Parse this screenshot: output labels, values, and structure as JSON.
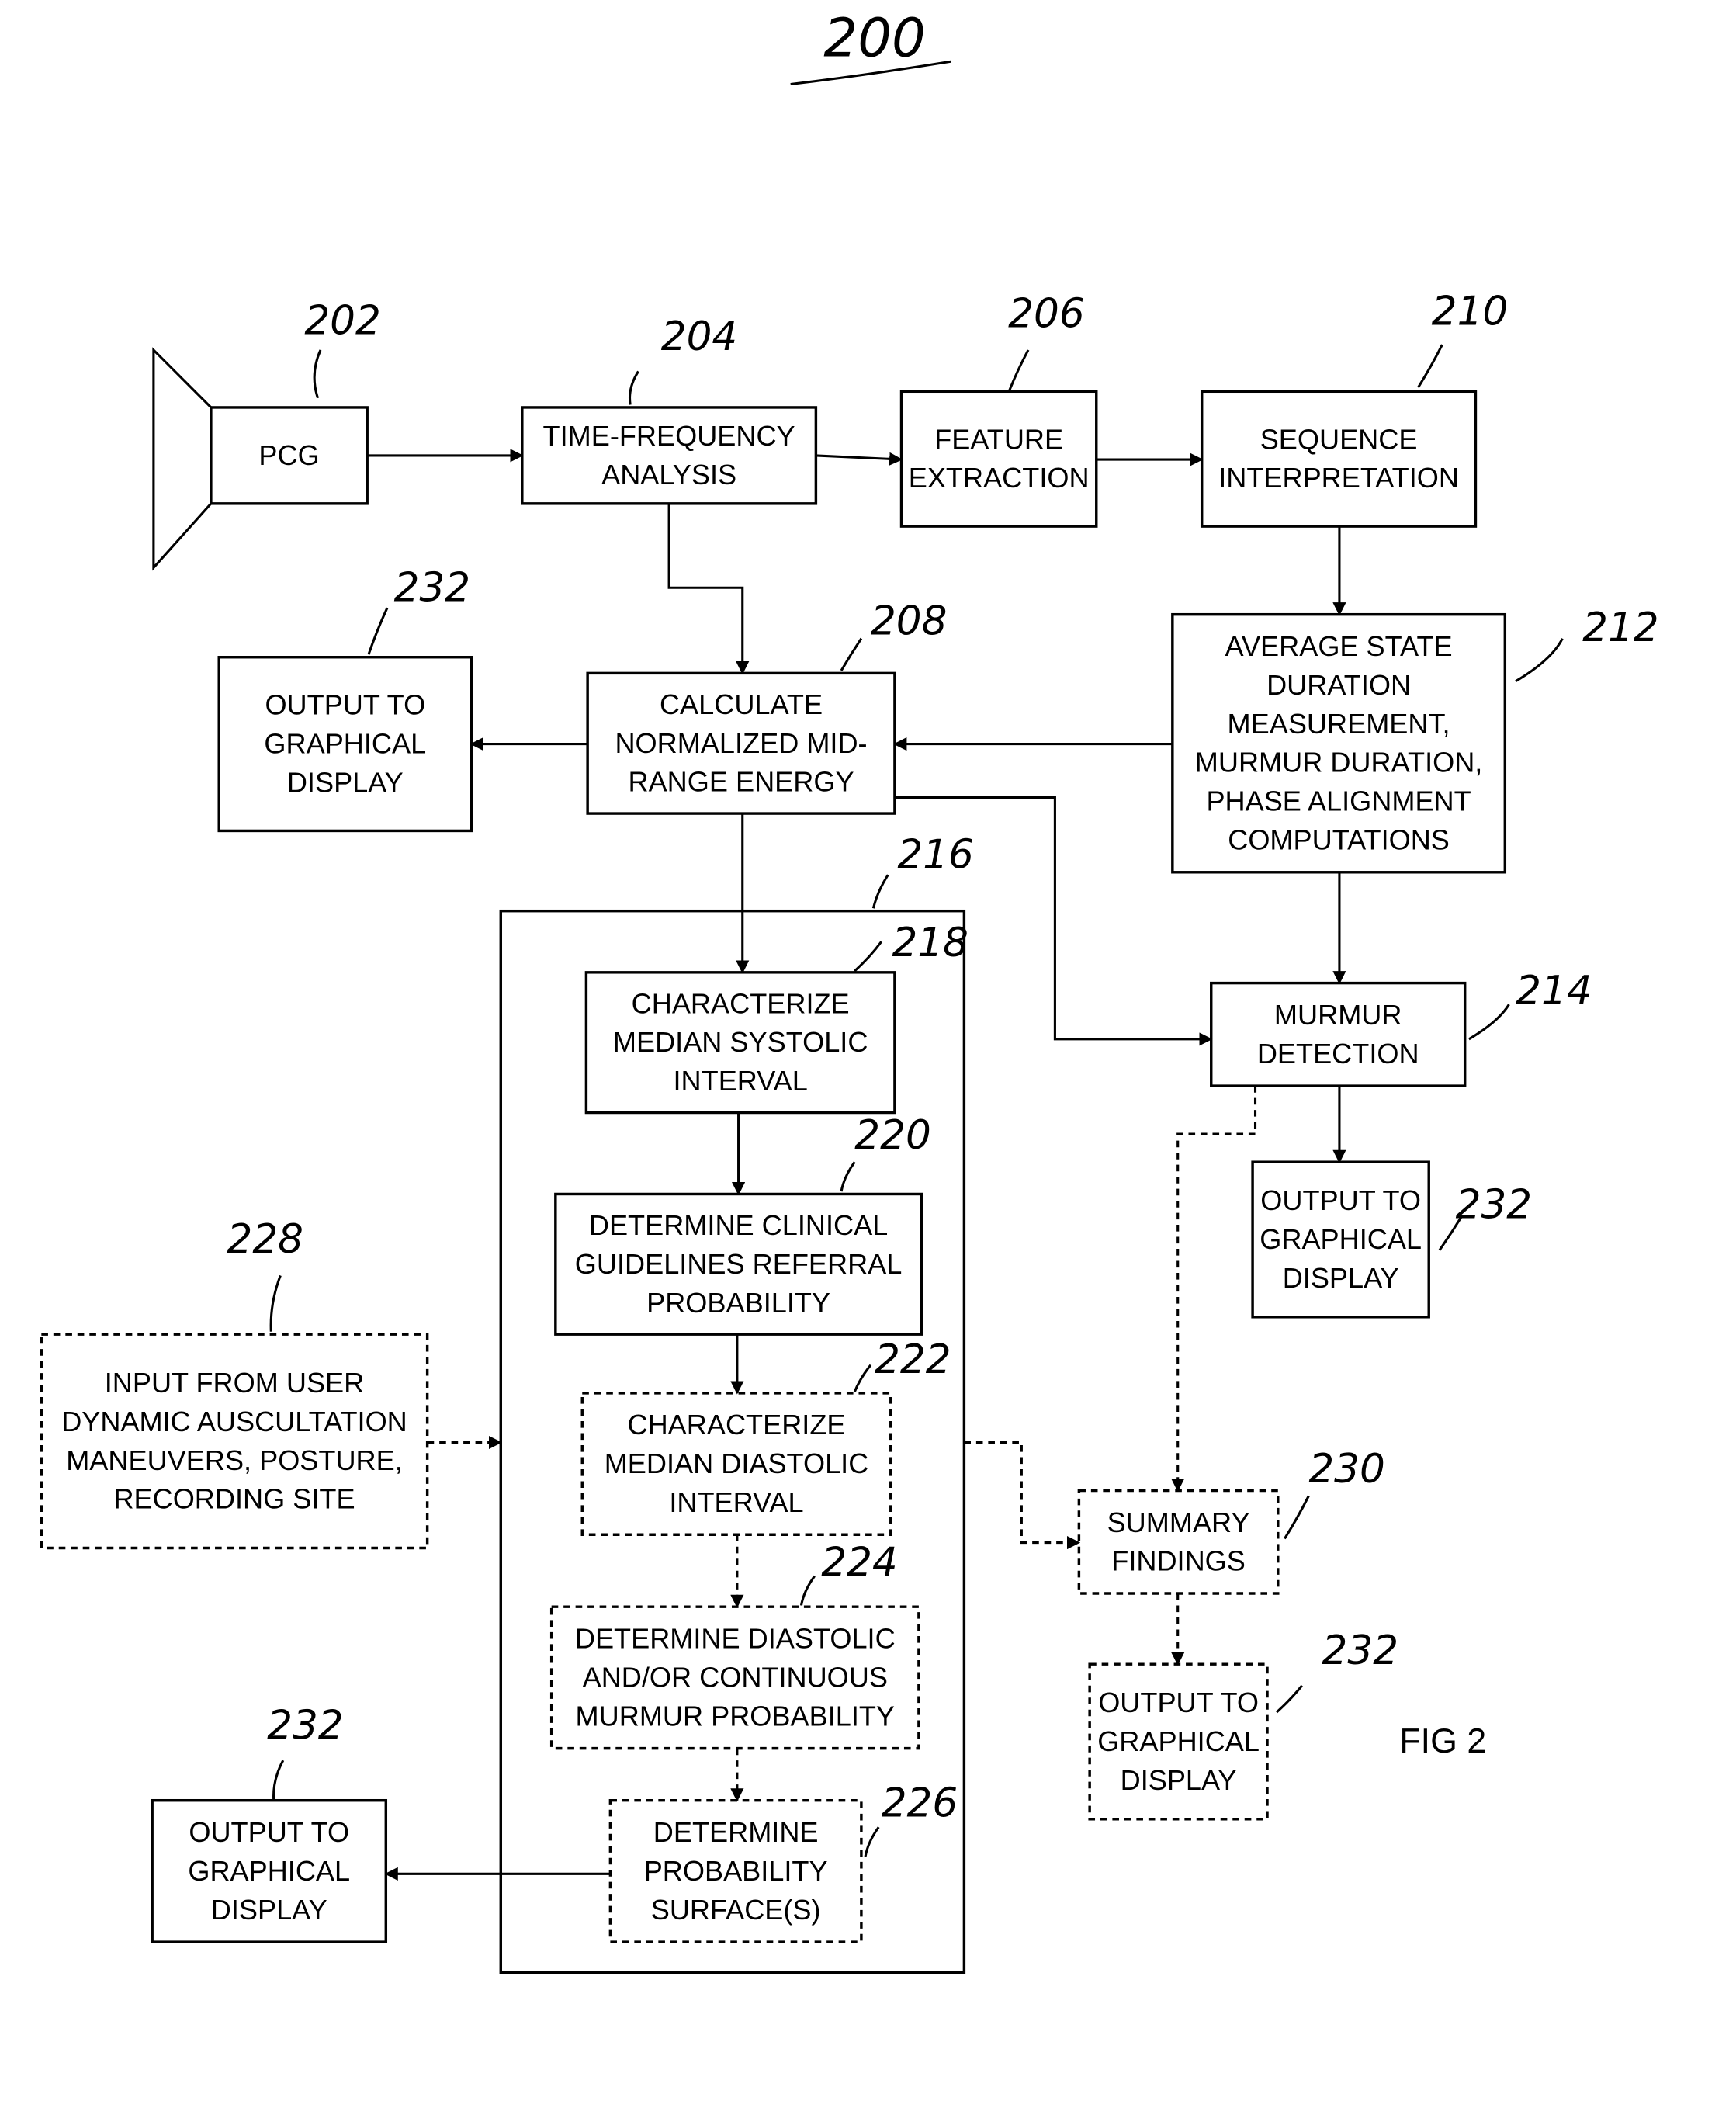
{
  "figure": {
    "number": "200",
    "caption": "FIG 2"
  },
  "blocks": {
    "pcg": {
      "ref": "202",
      "lines": [
        "PCG"
      ]
    },
    "tfa": {
      "ref": "204",
      "lines": [
        "TIME-FREQUENCY",
        "ANALYSIS"
      ]
    },
    "feature": {
      "ref": "206",
      "lines": [
        "FEATURE",
        "EXTRACTION"
      ]
    },
    "calc": {
      "ref": "208",
      "lines": [
        "CALCULATE",
        "NORMALIZED MID-",
        "RANGE ENERGY"
      ]
    },
    "sequence": {
      "ref": "210",
      "lines": [
        "SEQUENCE",
        "INTERPRETATION"
      ]
    },
    "average": {
      "ref": "212",
      "lines": [
        "AVERAGE STATE",
        "DURATION",
        "MEASUREMENT,",
        "MURMUR DURATION,",
        "PHASE ALIGNMENT",
        "COMPUTATIONS"
      ]
    },
    "murmur": {
      "ref": "214",
      "lines": [
        "MURMUR",
        "DETECTION"
      ]
    },
    "group": {
      "ref": "216"
    },
    "systolic": {
      "ref": "218",
      "lines": [
        "CHARACTERIZE",
        "MEDIAN SYSTOLIC",
        "INTERVAL"
      ]
    },
    "clinical": {
      "ref": "220",
      "lines": [
        "DETERMINE CLINICAL",
        "GUIDELINES REFERRAL",
        "PROBABILITY"
      ]
    },
    "diastolic": {
      "ref": "222",
      "lines": [
        "CHARACTERIZE",
        "MEDIAN DIASTOLIC",
        "INTERVAL"
      ]
    },
    "continuous": {
      "ref": "224",
      "lines": [
        "DETERMINE DIASTOLIC",
        "AND/OR CONTINUOUS",
        "MURMUR PROBABILITY"
      ]
    },
    "surface": {
      "ref": "226",
      "lines": [
        "DETERMINE",
        "PROBABILITY",
        "SURFACE(S)"
      ]
    },
    "input": {
      "ref": "228",
      "lines": [
        "INPUT FROM USER",
        "DYNAMIC AUSCULTATION",
        "MANEUVERS, POSTURE,",
        "RECORDING SITE"
      ]
    },
    "summary": {
      "ref": "230",
      "lines": [
        "SUMMARY",
        "FINDINGS"
      ]
    },
    "out1": {
      "ref": "232",
      "lines": [
        "OUTPUT TO",
        "GRAPHICAL",
        "DISPLAY"
      ]
    },
    "out2": {
      "ref": "232",
      "lines": [
        "OUTPUT TO",
        "GRAPHICAL",
        "DISPLAY"
      ]
    },
    "out3": {
      "ref": "232",
      "lines": [
        "OUTPUT TO",
        "GRAPHICAL",
        "DISPLAY"
      ]
    },
    "out4": {
      "ref": "232",
      "lines": [
        "OUTPUT TO",
        "GRAPHICAL",
        "DISPLAY"
      ]
    }
  }
}
